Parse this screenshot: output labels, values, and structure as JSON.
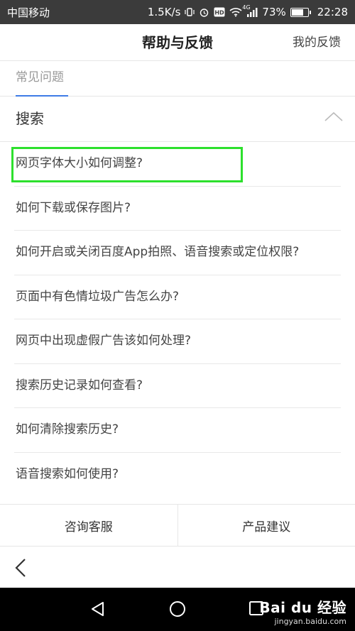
{
  "status_bar": {
    "carrier": "中国移动",
    "speed": "1.5K/s",
    "network": "4G",
    "battery": "73%",
    "time": "22:28"
  },
  "header": {
    "title": "帮助与反馈",
    "my_feedback": "我的反馈"
  },
  "tabs": [
    {
      "label": "常见问题",
      "active": true
    }
  ],
  "section": {
    "title": "搜索",
    "expanded": true
  },
  "questions": [
    "网页字体大小如何调整?",
    "如何下载或保存图片?",
    "如何开启或关闭百度App拍照、语音搜索或定位权限?",
    "页面中有色情垃圾广告怎么办?",
    "网页中出现虚假广告该如何处理?",
    "搜索历史记录如何查看?",
    "如何清除搜索历史?",
    "语音搜索如何使用?"
  ],
  "actions": {
    "consult": "咨询客服",
    "suggest": "产品建议"
  },
  "watermark": {
    "brand": "Bai du 经验",
    "site": "jingyan.baidu.com"
  },
  "colors": {
    "accent": "#3e7be6",
    "highlight": "#2de02d",
    "status_bar_bg": "#3b3b3b"
  }
}
